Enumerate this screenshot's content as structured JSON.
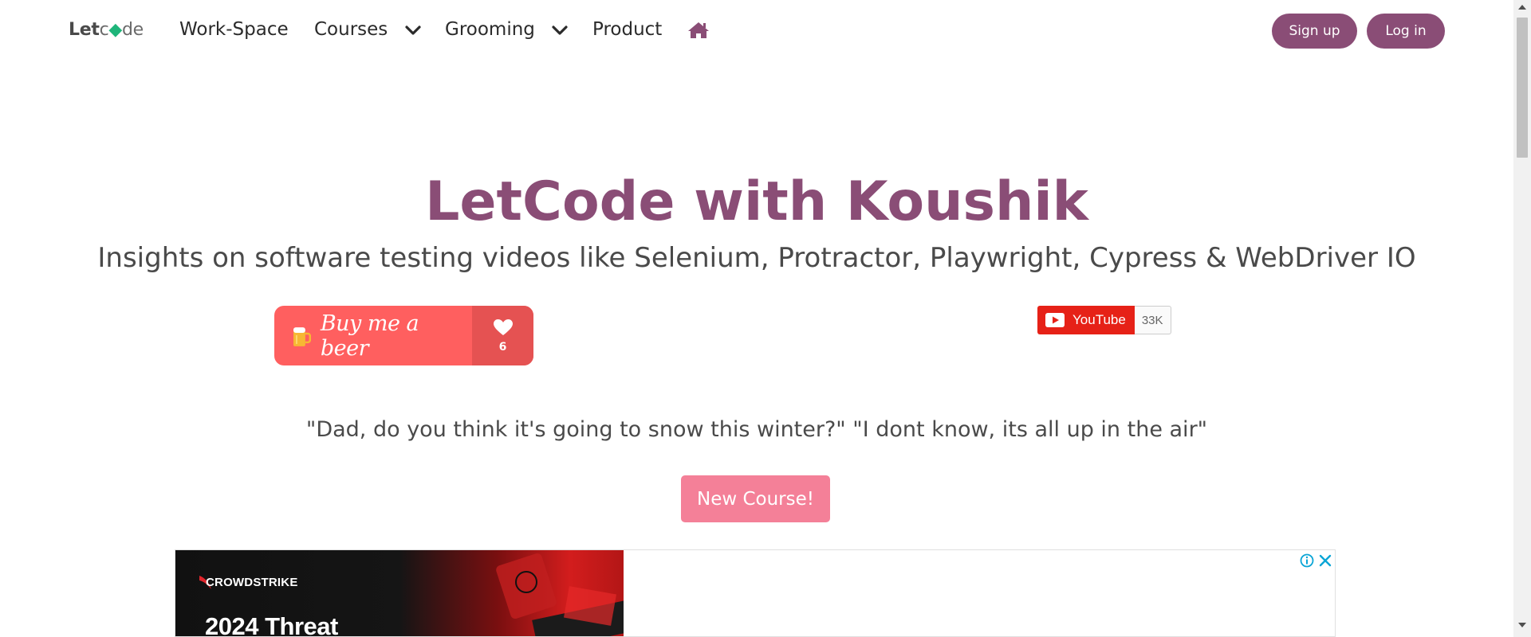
{
  "navbar": {
    "logo": {
      "let": "Let",
      "c": "c",
      "o": "◆",
      "de": "de"
    },
    "items": [
      {
        "label": "Work-Space"
      },
      {
        "label": "Courses"
      },
      {
        "label": "Grooming"
      },
      {
        "label": "Product"
      }
    ],
    "home_icon": "home-icon",
    "signup_label": "Sign up",
    "login_label": "Log in"
  },
  "hero": {
    "title": "LetCode with Koushik",
    "subtitle": "Insights on software testing videos like Selenium, Protractor, Playwright, Cypress & WebDriver IO"
  },
  "buy_me_a_beer": {
    "label": "Buy me a beer",
    "count": "6",
    "mug_icon": "beer-mug-icon",
    "heart_icon": "heart-icon"
  },
  "youtube": {
    "label": "YouTube",
    "count": "33K",
    "icon": "youtube-play-icon"
  },
  "joke": "\"Dad, do you think it's going to snow this winter?\" \"I dont know, its all up in the air\"",
  "new_course_label": "New Course!",
  "ad": {
    "brand": "CROWDSTRIKE",
    "headline": "2024 Threat",
    "info_icon": "info-icon",
    "close_icon": "close-icon"
  },
  "colors": {
    "brand_purple": "#8a4d76",
    "bmc_red": "#ff5f5f",
    "new_course_pink": "#f48098",
    "youtube_red": "#e62117"
  }
}
